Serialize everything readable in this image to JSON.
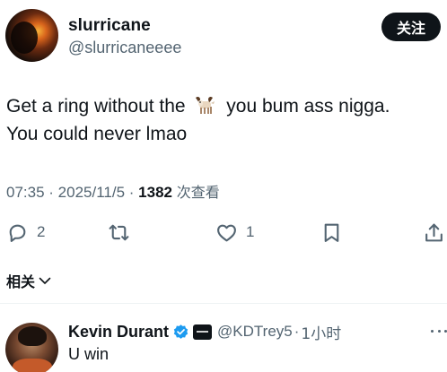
{
  "tweet": {
    "author": {
      "display_name": "slurricane",
      "handle": "@slurricaneeee"
    },
    "follow_label": "关注",
    "text_line1_before": "Get a ring without the",
    "emoji": "goat-emoji",
    "text_line1_after": "you bum ass nigga.",
    "text_line2": "You could never lmao",
    "time": "07:35",
    "separator": "·",
    "date": "2025/11/5",
    "views_count": "1382",
    "views_label": "次查看"
  },
  "actions": {
    "reply_count": "2",
    "like_count": "1",
    "icons": [
      "reply-icon",
      "retweet-icon",
      "like-icon",
      "bookmark-icon",
      "share-icon"
    ]
  },
  "related": {
    "label": "相关"
  },
  "reply": {
    "display_name": "Kevin Durant",
    "handle": "@KDTrey5",
    "separator": "·",
    "time": "1小时",
    "text": "U win"
  },
  "colors": {
    "text": "#0f1419",
    "secondary": "#536471",
    "verified": "#1d9bf0",
    "follow_bg": "#0f1419"
  }
}
